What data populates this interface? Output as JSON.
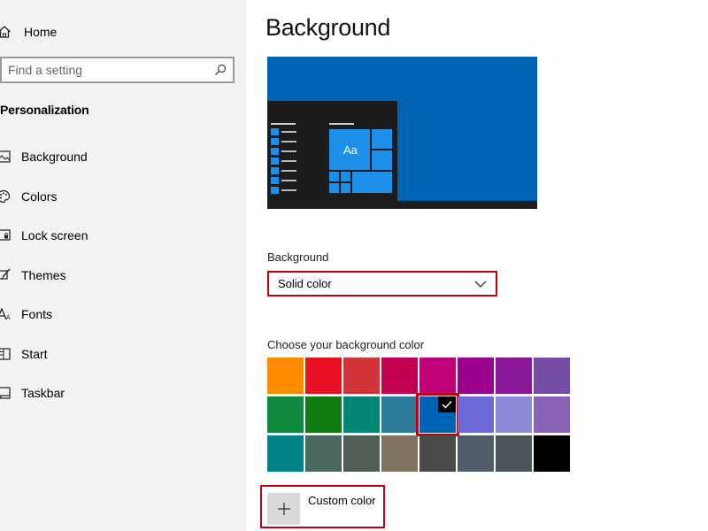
{
  "sidebar": {
    "home_label": "Home",
    "search_placeholder": "Find a setting",
    "section_title": "Personalization",
    "items": [
      {
        "label": "Background",
        "icon": "picture-icon"
      },
      {
        "label": "Colors",
        "icon": "palette-icon"
      },
      {
        "label": "Lock screen",
        "icon": "lock-screen-icon"
      },
      {
        "label": "Themes",
        "icon": "brush-icon"
      },
      {
        "label": "Fonts",
        "icon": "font-icon"
      },
      {
        "label": "Start",
        "icon": "start-icon"
      },
      {
        "label": "Taskbar",
        "icon": "taskbar-icon"
      }
    ]
  },
  "main": {
    "title": "Background",
    "preview": {
      "tile_label": "Aa",
      "desktop_color": "#0063b1"
    },
    "background_label": "Background",
    "background_value": "Solid color",
    "choose_label": "Choose your background color",
    "colors": [
      "#ff8c00",
      "#e81123",
      "#d13438",
      "#c30052",
      "#bf0077",
      "#9a0089",
      "#881798",
      "#744da9",
      "#10893e",
      "#107c10",
      "#018574",
      "#2d7d9a",
      "#0063b1",
      "#6b69d6",
      "#8e8cd8",
      "#8764b8",
      "#038387",
      "#486860",
      "#525e54",
      "#7e735f",
      "#4c4a48",
      "#515c6b",
      "#4a5459",
      "#000000"
    ],
    "selected_color_index": 12,
    "custom_color_label": "Custom color"
  },
  "accent": {
    "highlight": "#c4000f",
    "sidebar_bg": "#f2f2f2"
  }
}
